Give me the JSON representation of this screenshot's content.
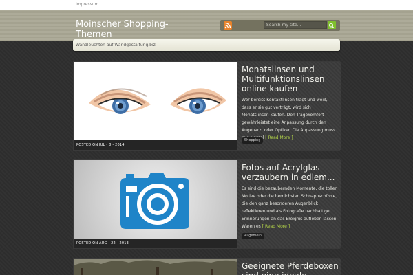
{
  "topbar": {
    "impressum_label": "Impressum"
  },
  "header": {
    "site_title": "Moinscher Shopping-Themen",
    "tagline": "Wandleuchten auf Wandgestaltung.biz",
    "search_placeholder": "Search my site..."
  },
  "colors": {
    "header_bg": "#a9a794",
    "page_bg": "#2e2e2e",
    "accent_link": "#b6d84a",
    "search_button": "#7fbf2c",
    "rss": "#e8822a"
  },
  "posts": [
    {
      "title": "Monatslinsen und Multifunktionslinsen online kaufen",
      "excerpt": "Wer bereits Kontaktlinsen trägt und weiß, dass er sie gut verträgt, wird sich Monatslinsen kaufen. Den Tragekomfort gewährleistet eine Anpassung durch den Augenarzt oder Optiker. Die Anpassung muss nur einmal",
      "read_more": "[ Read More ]",
      "posted_on": "POSTED ON JUL - 8 - 2014",
      "category": "Shopping",
      "thumbnail_icon": "eyes-illustration"
    },
    {
      "title": "Fotos auf Acrylglas verzaubern in edlem...",
      "excerpt": "Es sind die bezaubernden Momente, die tollen Motive oder die herrlichsten Schnappschüsse, die den ganz besonderen Augenblick reflektieren und als Fotografie nachhaltige Erinnerungen an das Ereignis aufleben lassen. Waren es",
      "read_more": "[ Read More ]",
      "posted_on": "POSTED ON AUG - 22 - 2013",
      "category": "Allgemein",
      "thumbnail_icon": "camera-icon"
    },
    {
      "title": "Geeignete Pferdeboxen sind eine ideale...",
      "thumbnail_icon": "trees-photo"
    }
  ]
}
